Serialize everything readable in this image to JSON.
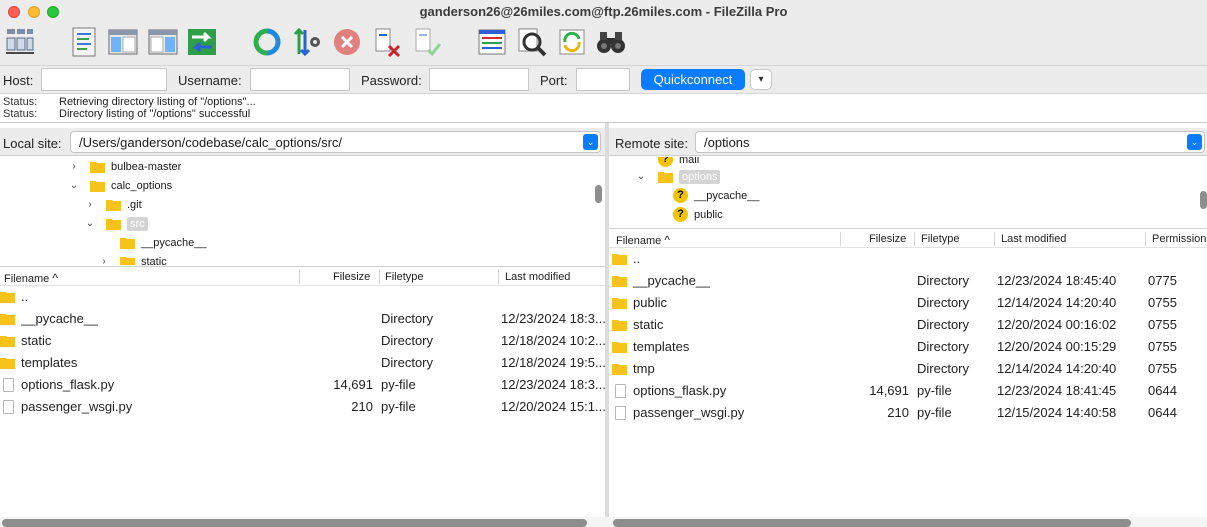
{
  "window": {
    "title": "ganderson26@26miles.com@ftp.26miles.com - FileZilla Pro"
  },
  "toolbar": {
    "buttons": [
      {
        "icon": "site-manager-icon"
      },
      {
        "icon": "message-log-icon"
      },
      {
        "icon": "local-tree-icon"
      },
      {
        "icon": "remote-tree-icon"
      },
      {
        "icon": "transfer-queue-icon"
      },
      {
        "icon": "refresh-icon"
      },
      {
        "icon": "process-queue-icon"
      },
      {
        "icon": "cancel-icon"
      },
      {
        "icon": "disconnect-icon"
      },
      {
        "icon": "reconnect-icon"
      },
      {
        "icon": "directory-listing-filters-icon"
      },
      {
        "icon": "toggle-comparison-icon"
      },
      {
        "icon": "synchronized-browsing-icon"
      },
      {
        "icon": "search-remote-files-icon"
      }
    ]
  },
  "quickconnect": {
    "host_label": "Host:",
    "host_value": "",
    "username_label": "Username:",
    "username_value": "",
    "password_label": "Password:",
    "password_value": "",
    "port_label": "Port:",
    "port_value": "",
    "connect_label": "Quickconnect",
    "dropdown_glyph": "▾"
  },
  "log": [
    {
      "key": "Status:",
      "message": "Retrieving directory listing of \"/options\"..."
    },
    {
      "key": "Status:",
      "message": "Directory listing of \"/options\" successful"
    }
  ],
  "local": {
    "site_label": "Local site:",
    "site_path": "/Users/ganderson/codebase/calc_options/src/",
    "tree": [
      {
        "chevron": "›",
        "label": "bulbea-master",
        "selected": false
      },
      {
        "chevron": "⌄",
        "label": "calc_options",
        "selected": false
      },
      {
        "chevron": "›",
        "label": ".git",
        "selected": false
      },
      {
        "chevron": "⌄",
        "label": "src",
        "selected": true
      },
      {
        "chevron": "",
        "label": "__pycache__",
        "selected": false
      },
      {
        "chevron": "›",
        "label": "static",
        "selected": false
      }
    ],
    "columns": {
      "name": "Filename",
      "size": "Filesize",
      "type": "Filetype",
      "modified": "Last modified",
      "sort_glyph": "^"
    },
    "files": [
      {
        "name": "..",
        "size": "",
        "type": "",
        "modified": "",
        "kind": "folder"
      },
      {
        "name": "__pycache__",
        "size": "",
        "type": "Directory",
        "modified": "12/23/2024 18:3...",
        "kind": "folder"
      },
      {
        "name": "static",
        "size": "",
        "type": "Directory",
        "modified": "12/18/2024 10:2...",
        "kind": "folder"
      },
      {
        "name": "templates",
        "size": "",
        "type": "Directory",
        "modified": "12/18/2024 19:5...",
        "kind": "folder"
      },
      {
        "name": "options_flask.py",
        "size": "14,691",
        "type": "py-file",
        "modified": "12/23/2024 18:3...",
        "kind": "file"
      },
      {
        "name": "passenger_wsgi.py",
        "size": "210",
        "type": "py-file",
        "modified": "12/20/2024 15:1...",
        "kind": "file"
      }
    ]
  },
  "remote": {
    "site_label": "Remote site:",
    "site_path": "/options",
    "tree": [
      {
        "chevron": "",
        "label": "mail",
        "selected": false,
        "kind": "unknown"
      },
      {
        "chevron": "⌄",
        "label": "options",
        "selected": true,
        "kind": "folder"
      },
      {
        "chevron": "",
        "label": "__pycache__",
        "selected": false,
        "kind": "unknown"
      },
      {
        "chevron": "",
        "label": "public",
        "selected": false,
        "kind": "unknown"
      }
    ],
    "columns": {
      "name": "Filename",
      "size": "Filesize",
      "type": "Filetype",
      "modified": "Last modified",
      "perms": "Permission",
      "sort_glyph": "^"
    },
    "files": [
      {
        "name": "..",
        "size": "",
        "type": "",
        "modified": "",
        "perms": "",
        "kind": "folder"
      },
      {
        "name": "__pycache__",
        "size": "",
        "type": "Directory",
        "modified": "12/23/2024 18:45:40",
        "perms": "0775",
        "kind": "folder"
      },
      {
        "name": "public",
        "size": "",
        "type": "Directory",
        "modified": "12/14/2024 14:20:40",
        "perms": "0755",
        "kind": "folder"
      },
      {
        "name": "static",
        "size": "",
        "type": "Directory",
        "modified": "12/20/2024 00:16:02",
        "perms": "0755",
        "kind": "folder"
      },
      {
        "name": "templates",
        "size": "",
        "type": "Directory",
        "modified": "12/20/2024 00:15:29",
        "perms": "0755",
        "kind": "folder"
      },
      {
        "name": "tmp",
        "size": "",
        "type": "Directory",
        "modified": "12/14/2024 14:20:40",
        "perms": "0755",
        "kind": "folder"
      },
      {
        "name": "options_flask.py",
        "size": "14,691",
        "type": "py-file",
        "modified": "12/23/2024 18:41:45",
        "perms": "0644",
        "kind": "file"
      },
      {
        "name": "passenger_wsgi.py",
        "size": "210",
        "type": "py-file",
        "modified": "12/15/2024 14:40:58",
        "perms": "0644",
        "kind": "file"
      }
    ]
  },
  "colors": {
    "accent": "#0a7cff",
    "folder": "#f7c21a",
    "chrome": "#ececec"
  }
}
